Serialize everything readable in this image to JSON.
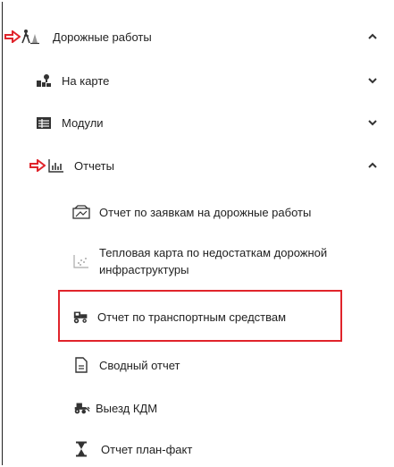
{
  "menu": {
    "road_works": {
      "label": "Дорожные работы",
      "icon": "road-works-icon",
      "state": "expanded"
    },
    "on_map": {
      "label": "На карте",
      "icon": "map-people-icon",
      "state": "collapsed"
    },
    "modules": {
      "label": "Модули",
      "icon": "modules-icon",
      "state": "collapsed"
    },
    "reports": {
      "label": "Отчеты",
      "icon": "chart-icon",
      "state": "expanded",
      "items": [
        {
          "label": "Отчет по заявкам на дорожные работы",
          "icon": "request-report-icon"
        },
        {
          "label_line1": "Тепловая карта по недостаткам дорожной",
          "label_line2": "инфраструктуры",
          "icon": "heatmap-icon"
        },
        {
          "label": "Отчет по транспортным средствам",
          "icon": "vehicle-icon",
          "highlighted": true
        },
        {
          "label": "Сводный отчет",
          "icon": "document-icon"
        },
        {
          "label": "Выезд КДМ",
          "icon": "tractor-icon"
        },
        {
          "label": "Отчет план-факт",
          "icon": "hourglass-icon"
        }
      ]
    }
  },
  "colors": {
    "annotation_red": "#e0242b",
    "text": "#222222"
  }
}
